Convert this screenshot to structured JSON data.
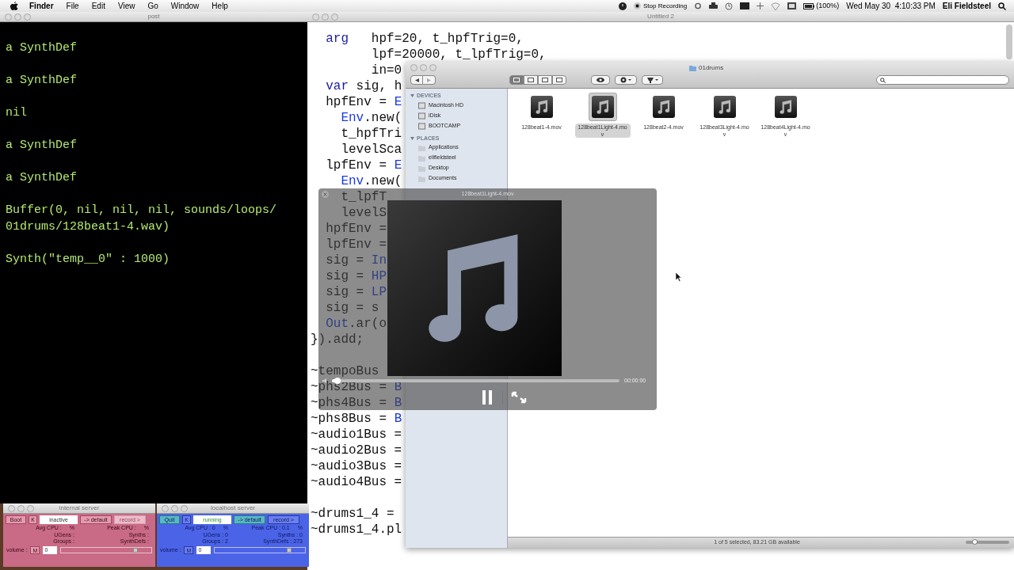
{
  "menu_bar": {
    "app": "Finder",
    "menus": [
      "File",
      "Edit",
      "View",
      "Go",
      "Window",
      "Help"
    ],
    "recording": "Stop Recording",
    "battery": "(100%)",
    "clock": "Wed May 30  4:10:33 PM",
    "user": "Eli Fieldsteel"
  },
  "post_window": {
    "title": "post",
    "lines": [
      "a SynthDef",
      "a SynthDef",
      "nil",
      "a SynthDef",
      "a SynthDef",
      "Buffer(0, nil, nil, nil, sounds/loops/ 01drums/128beat1-4.wav)",
      "Synth(\"temp__0\" : 1000)"
    ]
  },
  "editor": {
    "title": "Untitled 2",
    "lines": [
      {
        "kind": "code",
        "segments": [
          {
            "text": "  arg",
            "kind": "kw"
          },
          {
            "text": "   hpf=20, t_hpfTrig=0,",
            "kind": "plain"
          }
        ]
      },
      {
        "kind": "code",
        "segments": [
          {
            "text": "        lpf=20000, t_lpfTrig=0,",
            "kind": "plain"
          }
        ]
      },
      {
        "kind": "code",
        "segments": [
          {
            "text": "        in=0",
            "kind": "plain"
          }
        ]
      },
      {
        "kind": "code",
        "segments": [
          {
            "text": "  var",
            "kind": "kw"
          },
          {
            "text": " sig, h",
            "kind": "plain"
          }
        ]
      },
      {
        "kind": "code",
        "segments": [
          {
            "text": "  hpfEnv = ",
            "kind": "plain"
          },
          {
            "text": "E",
            "kind": "cls"
          }
        ]
      },
      {
        "kind": "code",
        "segments": [
          {
            "text": "    Env",
            "kind": "cls"
          },
          {
            "text": ".new(",
            "kind": "plain"
          }
        ]
      },
      {
        "kind": "code",
        "segments": [
          {
            "text": "    t_hpfTri",
            "kind": "plain"
          }
        ]
      },
      {
        "kind": "code",
        "segments": [
          {
            "text": "    levelSca",
            "kind": "plain"
          }
        ]
      },
      {
        "kind": "code",
        "segments": [
          {
            "text": "  lpfEnv = ",
            "kind": "plain"
          },
          {
            "text": "E",
            "kind": "cls"
          }
        ]
      },
      {
        "kind": "code",
        "segments": [
          {
            "text": "    Env",
            "kind": "cls"
          },
          {
            "text": ".new(",
            "kind": "plain"
          }
        ]
      },
      {
        "kind": "code",
        "segments": [
          {
            "text": "    t_lpfT",
            "kind": "plain"
          }
        ]
      },
      {
        "kind": "code",
        "segments": [
          {
            "text": "    levelS",
            "kind": "plain"
          }
        ]
      },
      {
        "kind": "code",
        "segments": [
          {
            "text": "  hpfEnv =",
            "kind": "plain"
          }
        ]
      },
      {
        "kind": "code",
        "segments": [
          {
            "text": "  lpfEnv =",
            "kind": "plain"
          }
        ]
      },
      {
        "kind": "code",
        "segments": [
          {
            "text": "  sig = ",
            "kind": "plain"
          },
          {
            "text": "In",
            "kind": "cls"
          }
        ]
      },
      {
        "kind": "code",
        "segments": [
          {
            "text": "  sig = ",
            "kind": "plain"
          },
          {
            "text": "HP",
            "kind": "cls"
          }
        ]
      },
      {
        "kind": "code",
        "segments": [
          {
            "text": "  sig = ",
            "kind": "plain"
          },
          {
            "text": "LP",
            "kind": "cls"
          }
        ]
      },
      {
        "kind": "code",
        "segments": [
          {
            "text": "  sig = s",
            "kind": "plain"
          }
        ]
      },
      {
        "kind": "code",
        "segments": [
          {
            "text": "  Out",
            "kind": "cls"
          },
          {
            "text": ".ar(o",
            "kind": "plain"
          }
        ]
      },
      {
        "kind": "code",
        "segments": [
          {
            "text": "}).add;",
            "kind": "plain"
          }
        ]
      },
      {
        "kind": "blank"
      },
      {
        "kind": "code",
        "segments": [
          {
            "text": "~tempoBus",
            "kind": "plain"
          }
        ]
      },
      {
        "kind": "code",
        "segments": [
          {
            "text": "~phs2Bus = ",
            "kind": "plain"
          },
          {
            "text": "B",
            "kind": "cls"
          }
        ]
      },
      {
        "kind": "code",
        "segments": [
          {
            "text": "~phs4Bus = ",
            "kind": "plain"
          },
          {
            "text": "B",
            "kind": "cls"
          }
        ]
      },
      {
        "kind": "code",
        "segments": [
          {
            "text": "~phs8Bus = ",
            "kind": "plain"
          },
          {
            "text": "B",
            "kind": "cls"
          }
        ]
      },
      {
        "kind": "code",
        "segments": [
          {
            "text": "~audio1Bus =",
            "kind": "plain"
          }
        ]
      },
      {
        "kind": "code",
        "segments": [
          {
            "text": "~audio2Bus =",
            "kind": "plain"
          }
        ]
      },
      {
        "kind": "code",
        "segments": [
          {
            "text": "~audio3Bus =",
            "kind": "plain"
          }
        ]
      },
      {
        "kind": "code",
        "segments": [
          {
            "text": "~audio4Bus =",
            "kind": "plain"
          }
        ]
      },
      {
        "kind": "blank"
      },
      {
        "kind": "code",
        "segments": [
          {
            "text": "~drums1_4 =",
            "kind": "plain"
          }
        ]
      },
      {
        "kind": "code",
        "segments": [
          {
            "text": "~drums1_4.pl",
            "kind": "plain"
          }
        ]
      }
    ]
  },
  "finder": {
    "title": "01drums",
    "devices_heading": "DEVICES",
    "devices": [
      "Macintosh HD",
      "iDisk",
      "BOOTCAMP"
    ],
    "places_heading": "PLACES",
    "places": [
      "Applications",
      "elifieldsteel",
      "Desktop",
      "Documents"
    ],
    "files": [
      {
        "name": "128beat1-4.mov",
        "selected": false
      },
      {
        "name": "128beat1Light-4.mov",
        "selected": true
      },
      {
        "name": "128beat2-4.mov",
        "selected": false
      },
      {
        "name": "128beat3Light-4.mov",
        "selected": false
      },
      {
        "name": "128beat4Light-4.mov",
        "selected": false
      }
    ],
    "status": "1 of 5 selected, 83.21 GB available",
    "icon_size": {
      "level": 0.2
    }
  },
  "quick_look": {
    "title": "128beat1Light-4.mov",
    "time": "00:00:00",
    "level": 0.02,
    "playing": true
  },
  "servers": [
    {
      "title": "internal server",
      "running": false,
      "boot": "Boot",
      "kill": "K",
      "status": "inactive",
      "default": "-> default",
      "record": "record >",
      "stats": [
        {
          "text": "Avg CPU :",
          "unit": "%"
        },
        {
          "text": "Peak CPU :",
          "unit": "%"
        },
        {
          "text": "UGens :"
        },
        {
          "text": "Synths :"
        },
        {
          "text": "Groups :"
        },
        {
          "text": "SynthDefs :"
        }
      ],
      "volume_label": "volume :",
      "mute": "M",
      "volume": "0",
      "level": 0.85
    },
    {
      "title": "localhost server",
      "running": true,
      "boot": "Quit",
      "kill": "K",
      "status": "running",
      "default": "-> default",
      "record": "record >",
      "stats": [
        {
          "text": "Avg CPU : 0",
          "unit": "%"
        },
        {
          "text": "Peak CPU : 0.1",
          "unit": "%"
        },
        {
          "text": "UGens : 0"
        },
        {
          "text": "Synths : 0"
        },
        {
          "text": "Groups : 2"
        },
        {
          "text": "SynthDefs : 273"
        }
      ],
      "volume_label": "volume :",
      "mute": "M",
      "volume": "0",
      "level": 0.85
    }
  ]
}
